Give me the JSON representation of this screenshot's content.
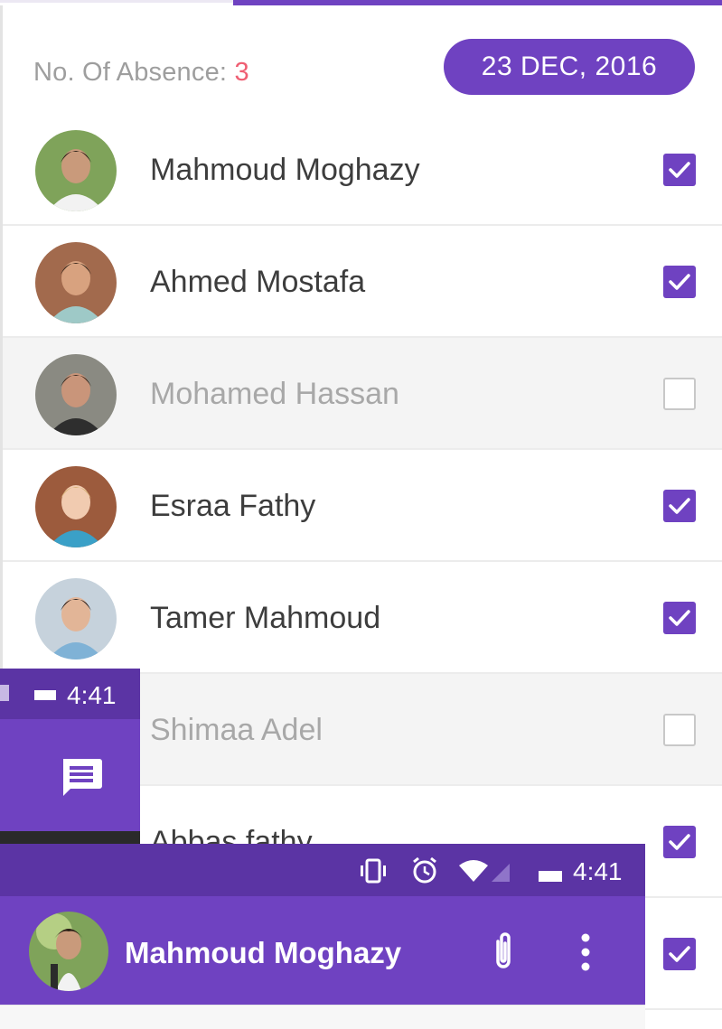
{
  "colors": {
    "accent": "#6f42c1",
    "accent_dark": "#5b34a4",
    "absence_count": "#ef5f73"
  },
  "header": {
    "absence_label": "No. Of Absence: ",
    "absence_count": "3",
    "date": "23 DEC, 2016"
  },
  "students": [
    {
      "name": "Mahmoud Moghazy",
      "present": true,
      "avatar": "student-photo-avatar"
    },
    {
      "name": "Ahmed Mostafa",
      "present": true,
      "avatar": "student-photo-avatar"
    },
    {
      "name": "Mohamed Hassan",
      "present": false,
      "avatar": "student-photo-avatar"
    },
    {
      "name": "Esraa Fathy",
      "present": true,
      "avatar": "student-photo-avatar"
    },
    {
      "name": "Tamer Mahmoud",
      "present": true,
      "avatar": "student-photo-avatar"
    },
    {
      "name": "Shimaa Adel",
      "present": false,
      "avatar": "student-photo-avatar"
    },
    {
      "name": "Abbas fathy",
      "present": true,
      "avatar": "student-photo-avatar"
    },
    {
      "name": "",
      "present": true,
      "avatar": "student-photo-avatar"
    }
  ],
  "overlay_chat_list": {
    "status_time": "4:41",
    "icons": [
      "signal-icon",
      "battery-icon",
      "chat-icon"
    ]
  },
  "overlay_chat_header": {
    "status_time": "4:41",
    "status_icons": [
      "vibrate-icon",
      "alarm-icon",
      "wifi-icon",
      "signal-icon",
      "battery-icon"
    ],
    "contact_name": "Mahmoud Moghazy",
    "action_icons": [
      "attach-icon",
      "more-vert-icon"
    ]
  }
}
